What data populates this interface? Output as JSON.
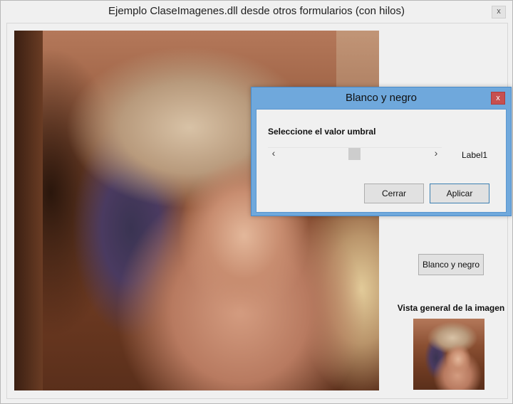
{
  "main_window": {
    "title": "Ejemplo ClaseImagenes.dll desde otros formularios (con hilos)",
    "close_glyph": "x"
  },
  "side_panel": {
    "bw_button_label": "Blanco y negro",
    "overview_label": "Vista general de la imagen"
  },
  "dialog": {
    "title": "Blanco y negro",
    "close_glyph": "x",
    "threshold_label": "Seleccione el valor umbral",
    "scroll_left_glyph": "‹",
    "scroll_right_glyph": "›",
    "value_label": "Label1",
    "cancel_label": "Cerrar",
    "apply_label": "Aplicar"
  },
  "colors": {
    "window_bg": "#f0f0f0",
    "dialog_frame": "#6fa8dc",
    "close_red": "#c75050",
    "default_button_border": "#3c7fb1"
  }
}
